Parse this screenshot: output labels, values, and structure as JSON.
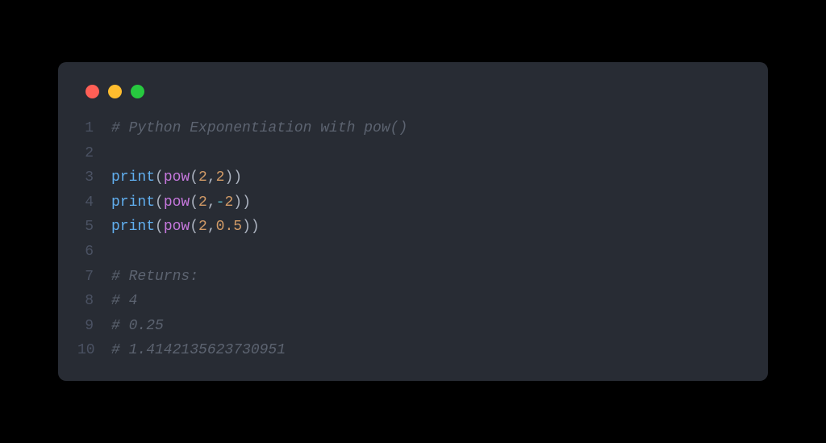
{
  "lines": [
    {
      "no": "1",
      "tokens": [
        {
          "cls": "c",
          "t": "# Python Exponentiation with pow()"
        }
      ]
    },
    {
      "no": "2",
      "tokens": [
        {
          "cls": "p",
          "t": ""
        }
      ]
    },
    {
      "no": "3",
      "tokens": [
        {
          "cls": "fn",
          "t": "print"
        },
        {
          "cls": "p",
          "t": "("
        },
        {
          "cls": "kw",
          "t": "pow"
        },
        {
          "cls": "p",
          "t": "("
        },
        {
          "cls": "n",
          "t": "2"
        },
        {
          "cls": "p",
          "t": ","
        },
        {
          "cls": "n",
          "t": "2"
        },
        {
          "cls": "p",
          "t": "))"
        }
      ]
    },
    {
      "no": "4",
      "tokens": [
        {
          "cls": "fn",
          "t": "print"
        },
        {
          "cls": "p",
          "t": "("
        },
        {
          "cls": "kw",
          "t": "pow"
        },
        {
          "cls": "p",
          "t": "("
        },
        {
          "cls": "n",
          "t": "2"
        },
        {
          "cls": "p",
          "t": ","
        },
        {
          "cls": "op",
          "t": "-"
        },
        {
          "cls": "n",
          "t": "2"
        },
        {
          "cls": "p",
          "t": "))"
        }
      ]
    },
    {
      "no": "5",
      "tokens": [
        {
          "cls": "fn",
          "t": "print"
        },
        {
          "cls": "p",
          "t": "("
        },
        {
          "cls": "kw",
          "t": "pow"
        },
        {
          "cls": "p",
          "t": "("
        },
        {
          "cls": "n",
          "t": "2"
        },
        {
          "cls": "p",
          "t": ","
        },
        {
          "cls": "n",
          "t": "0.5"
        },
        {
          "cls": "p",
          "t": "))"
        }
      ]
    },
    {
      "no": "6",
      "tokens": [
        {
          "cls": "p",
          "t": ""
        }
      ]
    },
    {
      "no": "7",
      "tokens": [
        {
          "cls": "c",
          "t": "# Returns:"
        }
      ]
    },
    {
      "no": "8",
      "tokens": [
        {
          "cls": "c",
          "t": "# 4"
        }
      ]
    },
    {
      "no": "9",
      "tokens": [
        {
          "cls": "c",
          "t": "# 0.25"
        }
      ]
    },
    {
      "no": "10",
      "tokens": [
        {
          "cls": "c",
          "t": "# 1.4142135623730951"
        }
      ]
    }
  ]
}
